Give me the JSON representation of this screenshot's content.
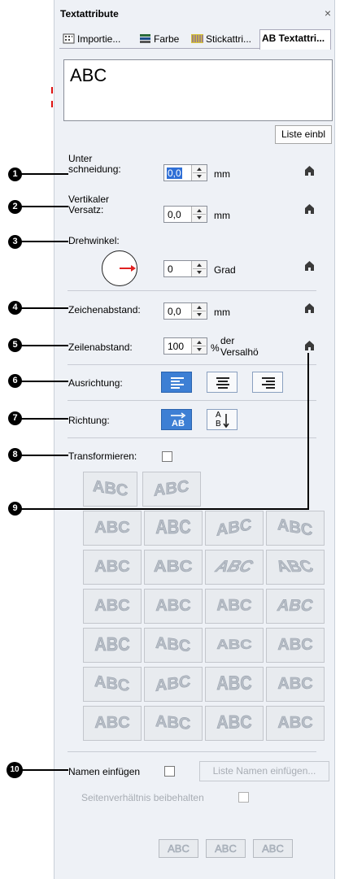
{
  "window": {
    "title": "Textattribute",
    "close_glyph": "×"
  },
  "tabs": [
    {
      "label": "Importie...",
      "icon": "import-icon",
      "active": false
    },
    {
      "label": "Farbe",
      "icon": "color-icon",
      "active": false
    },
    {
      "label": "Stickattri...",
      "icon": "stitch-icon",
      "active": false
    },
    {
      "label": "AB Textattri...",
      "icon": "text-attr-icon",
      "active": true
    }
  ],
  "text_input": {
    "value": "ABC"
  },
  "list_button": "Liste einbl",
  "fields": {
    "underscore": {
      "label_line1": "Unter",
      "label_line2": "schneidung:",
      "value": "0,0",
      "unit": "mm"
    },
    "vertical_offset": {
      "label_line1": "Vertikaler",
      "label_line2": "Versatz:",
      "value": "0,0",
      "unit": "mm"
    },
    "rotation": {
      "label": "Drehwinkel:",
      "value": "0",
      "unit": "Grad"
    },
    "char_spacing": {
      "label": "Zeichenabstand:",
      "value": "0,0",
      "unit": "mm"
    },
    "line_spacing": {
      "label": "Zeilenabstand:",
      "value": "100",
      "unit_line1": "der",
      "unit_line2": "Versalhö",
      "unit_prefix": "%"
    }
  },
  "alignment": {
    "label": "Ausrichtung:",
    "selected": "left"
  },
  "direction": {
    "label": "Richtung:",
    "selected": "horizontal",
    "h_label": "AB",
    "v_label_top": "A",
    "v_label_bottom": "B"
  },
  "transform": {
    "label": "Transformieren:",
    "checked": false
  },
  "transform_tiles": [
    "ABC",
    "ABC",
    "ABC",
    "ABC",
    "ABC",
    "ABC",
    "ABC",
    "ABC",
    "ABC",
    "ABC",
    "ABC",
    "ABC",
    "ABC",
    "ABC",
    "ABC",
    "ABC",
    "ABC",
    "ABC",
    "ABC",
    "ABC",
    "ABC",
    "ABC",
    "ABC",
    "ABC",
    "ABC",
    "ABC"
  ],
  "names": {
    "insert_label": "Namen einfügen",
    "insert_checked": false,
    "list_button": "Liste Namen einfügen...",
    "aspect_label": "Seitenverhältnis beibehalten",
    "aspect_checked": false,
    "small_tiles": [
      "ABC",
      "ABC",
      "ABC"
    ]
  },
  "callouts": [
    "1",
    "2",
    "3",
    "4",
    "5",
    "6",
    "7",
    "8",
    "9",
    "10"
  ],
  "colors": {
    "accent": "#3d7fd4",
    "panel": "#eef1f6",
    "arrow": "#e02020"
  }
}
